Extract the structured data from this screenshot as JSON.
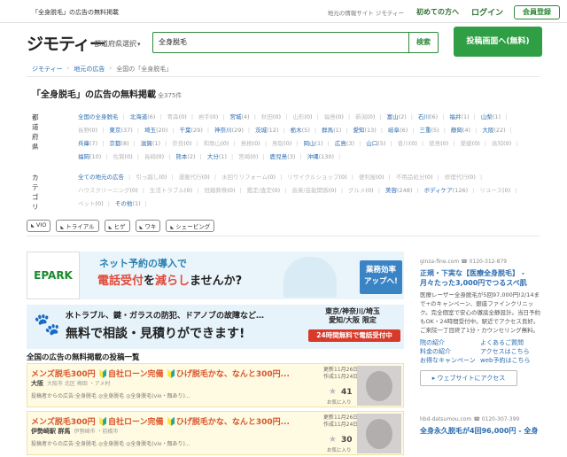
{
  "topbar": {
    "tagline": "「全身脱毛」の広告の無料掲載",
    "link_ad": "地元の情報サイト ジモティー",
    "link_first": "初めての方へ",
    "login": "ログイン",
    "register": "会員登録"
  },
  "header": {
    "logo": "ジモティー",
    "pref_select": "都道府県選択",
    "search_value": "全身脱毛",
    "search_button": "検索",
    "post_button": "投稿画面へ(無料)"
  },
  "breadcrumb": [
    "ジモティー",
    "地元の広告",
    "全国の「全身脱毛」"
  ],
  "page_title": "「全身脱毛」の広告の無料掲載",
  "page_count": "全375件",
  "pref_filter": {
    "label": "都道府県",
    "items": [
      {
        "name": "全国の全身脱毛",
        "count": "",
        "disabled": false
      },
      {
        "name": "北海道",
        "count": "(6)",
        "disabled": false
      },
      {
        "name": "青森",
        "count": "(0)",
        "disabled": true
      },
      {
        "name": "岩手",
        "count": "(0)",
        "disabled": true
      },
      {
        "name": "宮城",
        "count": "(4)",
        "disabled": false
      },
      {
        "name": "秋田",
        "count": "(0)",
        "disabled": true
      },
      {
        "name": "山形",
        "count": "(0)",
        "disabled": true
      },
      {
        "name": "福島",
        "count": "(0)",
        "disabled": true
      },
      {
        "name": "新潟",
        "count": "(0)",
        "disabled": true
      },
      {
        "name": "富山",
        "count": "(2)",
        "disabled": false
      },
      {
        "name": "石川",
        "count": "(6)",
        "disabled": false
      },
      {
        "name": "福井",
        "count": "(1)",
        "disabled": false
      },
      {
        "name": "山梨",
        "count": "(1)",
        "disabled": false
      },
      {
        "name": "長野",
        "count": "(0)",
        "disabled": true
      },
      {
        "name": "東京",
        "count": "(37)",
        "disabled": false
      },
      {
        "name": "埼玉",
        "count": "(20)",
        "disabled": false
      },
      {
        "name": "千葉",
        "count": "(29)",
        "disabled": false
      },
      {
        "name": "神奈川",
        "count": "(29)",
        "disabled": false
      },
      {
        "name": "茨城",
        "count": "(12)",
        "disabled": false
      },
      {
        "name": "栃木",
        "count": "(5)",
        "disabled": false
      },
      {
        "name": "群馬",
        "count": "(1)",
        "disabled": false
      },
      {
        "name": "愛知",
        "count": "(13)",
        "disabled": false
      },
      {
        "name": "岐阜",
        "count": "(6)",
        "disabled": false
      },
      {
        "name": "三重",
        "count": "(5)",
        "disabled": false
      },
      {
        "name": "静岡",
        "count": "(4)",
        "disabled": false
      },
      {
        "name": "大阪",
        "count": "(22)",
        "disabled": false
      },
      {
        "name": "兵庫",
        "count": "(7)",
        "disabled": false
      },
      {
        "name": "京都",
        "count": "(8)",
        "disabled": false
      },
      {
        "name": "滋賀",
        "count": "(1)",
        "disabled": false
      },
      {
        "name": "奈良",
        "count": "(0)",
        "disabled": true
      },
      {
        "name": "和歌山",
        "count": "(0)",
        "disabled": true
      },
      {
        "name": "島根",
        "count": "(0)",
        "disabled": true
      },
      {
        "name": "鳥取",
        "count": "(0)",
        "disabled": true
      },
      {
        "name": "岡山",
        "count": "(1)",
        "disabled": false
      },
      {
        "name": "広島",
        "count": "(3)",
        "disabled": false
      },
      {
        "name": "山口",
        "count": "(5)",
        "disabled": false
      },
      {
        "name": "香川",
        "count": "(0)",
        "disabled": true
      },
      {
        "name": "徳島",
        "count": "(0)",
        "disabled": true
      },
      {
        "name": "愛媛",
        "count": "(0)",
        "disabled": true
      },
      {
        "name": "高知",
        "count": "(0)",
        "disabled": true
      },
      {
        "name": "福岡",
        "count": "(10)",
        "disabled": false
      },
      {
        "name": "佐賀",
        "count": "(0)",
        "disabled": true
      },
      {
        "name": "長崎",
        "count": "(0)",
        "disabled": true
      },
      {
        "name": "熊本",
        "count": "(2)",
        "disabled": false
      },
      {
        "name": "大分",
        "count": "(1)",
        "disabled": false
      },
      {
        "name": "宮崎",
        "count": "(0)",
        "disabled": true
      },
      {
        "name": "鹿児島",
        "count": "(3)",
        "disabled": false
      },
      {
        "name": "沖縄",
        "count": "(130)",
        "disabled": false
      }
    ]
  },
  "cat_filter": {
    "label": "カテゴリ",
    "items": [
      {
        "name": "全ての地元の広告",
        "count": "",
        "disabled": false
      },
      {
        "name": "引っ越し",
        "count": "(0)",
        "disabled": true
      },
      {
        "name": "運搬代行",
        "count": "(0)",
        "disabled": true
      },
      {
        "name": "水回りリフォーム",
        "count": "(0)",
        "disabled": true
      },
      {
        "name": "リサイクルショップ",
        "count": "(0)",
        "disabled": true
      },
      {
        "name": "便利屋",
        "count": "(0)",
        "disabled": true
      },
      {
        "name": "不用品処分",
        "count": "(0)",
        "disabled": true
      },
      {
        "name": "修理代行",
        "count": "(0)",
        "disabled": true
      },
      {
        "name": "ハウスクリーニング",
        "count": "(0)",
        "disabled": true
      },
      {
        "name": "生活トラブル",
        "count": "(0)",
        "disabled": true
      },
      {
        "name": "冠婚葬祭",
        "count": "(0)",
        "disabled": true
      },
      {
        "name": "鑑定/査定",
        "count": "(0)",
        "disabled": true
      },
      {
        "name": "音楽/芸能関係",
        "count": "(0)",
        "disabled": true
      },
      {
        "name": "グルメ",
        "count": "(0)",
        "disabled": true
      },
      {
        "name": "美容",
        "count": "(248)",
        "disabled": false
      },
      {
        "name": "ボディケア",
        "count": "(126)",
        "disabled": false
      },
      {
        "name": "リユース",
        "count": "(0)",
        "disabled": true
      },
      {
        "name": "ペット",
        "count": "(0)",
        "disabled": true
      },
      {
        "name": "その他",
        "count": "(1)",
        "disabled": false
      }
    ]
  },
  "tags": [
    "VIO",
    "トライアル",
    "ヒゲ",
    "ワキ",
    "シェービング"
  ],
  "ad1": {
    "logo": "EPARK",
    "line1": "ネット予約の導入で",
    "line2a": "電話受付",
    "line2b": "を",
    "line2c": "減らし",
    "line2d": "ませんか?",
    "badge1": "業務効率",
    "badge2": "アップへ!"
  },
  "ad2": {
    "line1": "水トラブル、鍵・ガラスの防犯、ドアノブの故障など…",
    "line2": "無料で相談・見積りができます!",
    "areas1": "東京/神奈川/埼玉",
    "areas2": "愛知/大阪 限定",
    "phone": "24時間無料で電話受付中"
  },
  "list_title": "全国の広告の無料掲載の投稿一覧",
  "cards": [
    {
      "title": "メンズ脱毛300円 🔰自社ローン完備 🔰ひげ脱毛かな、なんと300円...",
      "location": "大阪",
      "loc_sub": "大阪市 北区 梅田 ・アメ村",
      "desc": "投稿者からの広告:全身脱毛 ◎全身脱毛 ◎全身脱毛(vio・顔あり)...",
      "date1": "更新11月26日",
      "date2": "作成11月24日",
      "count": "41",
      "fav": "お気に入り"
    },
    {
      "title": "メンズ脱毛300円 🔰自社ローン完備 🔰ひげ脱毛かな、なんと300円...",
      "location": "伊勢崎駅 群馬",
      "loc_sub": "伊勢崎市 ・前橋市",
      "desc": "投稿者からの広告:全身脱毛 ◎全身脱毛 ◎全身脱毛(vio・顔あり)...",
      "date1": "更新11月26日",
      "date2": "作成11月24日",
      "count": "30",
      "fav": "お気に入り"
    }
  ],
  "side_ad1": {
    "url": "ginza-fine.com",
    "phone": "0120-312-879",
    "title": "正規・下実な【医療全身脱毛】 - 月々たった3,000円でつるスベ肌",
    "body": "医療レーザー全身脱毛が5回97,000円!2/14まで+のキャンペーン、銀座ファインクリニック。完全個室で安心の徹底全静設計。当日予約もOK・24時間受付中。駅近でアクセス良好。ご来院一丁目終了1分・カウンセリング無料。",
    "link1": "院の紹介",
    "link2": "料金の紹介",
    "link3": "よくあるご質問",
    "link4": "アクセスはこちら",
    "link5": "お得なキャンペーン",
    "link6": "web予約はこちら",
    "web_button": "ウェブサイトにアクセス"
  },
  "side_ad2": {
    "url": "hbd-datsumou.com",
    "phone": "0120-307-399",
    "title": "全身永久脱毛が4回96,000円 - 全身"
  }
}
